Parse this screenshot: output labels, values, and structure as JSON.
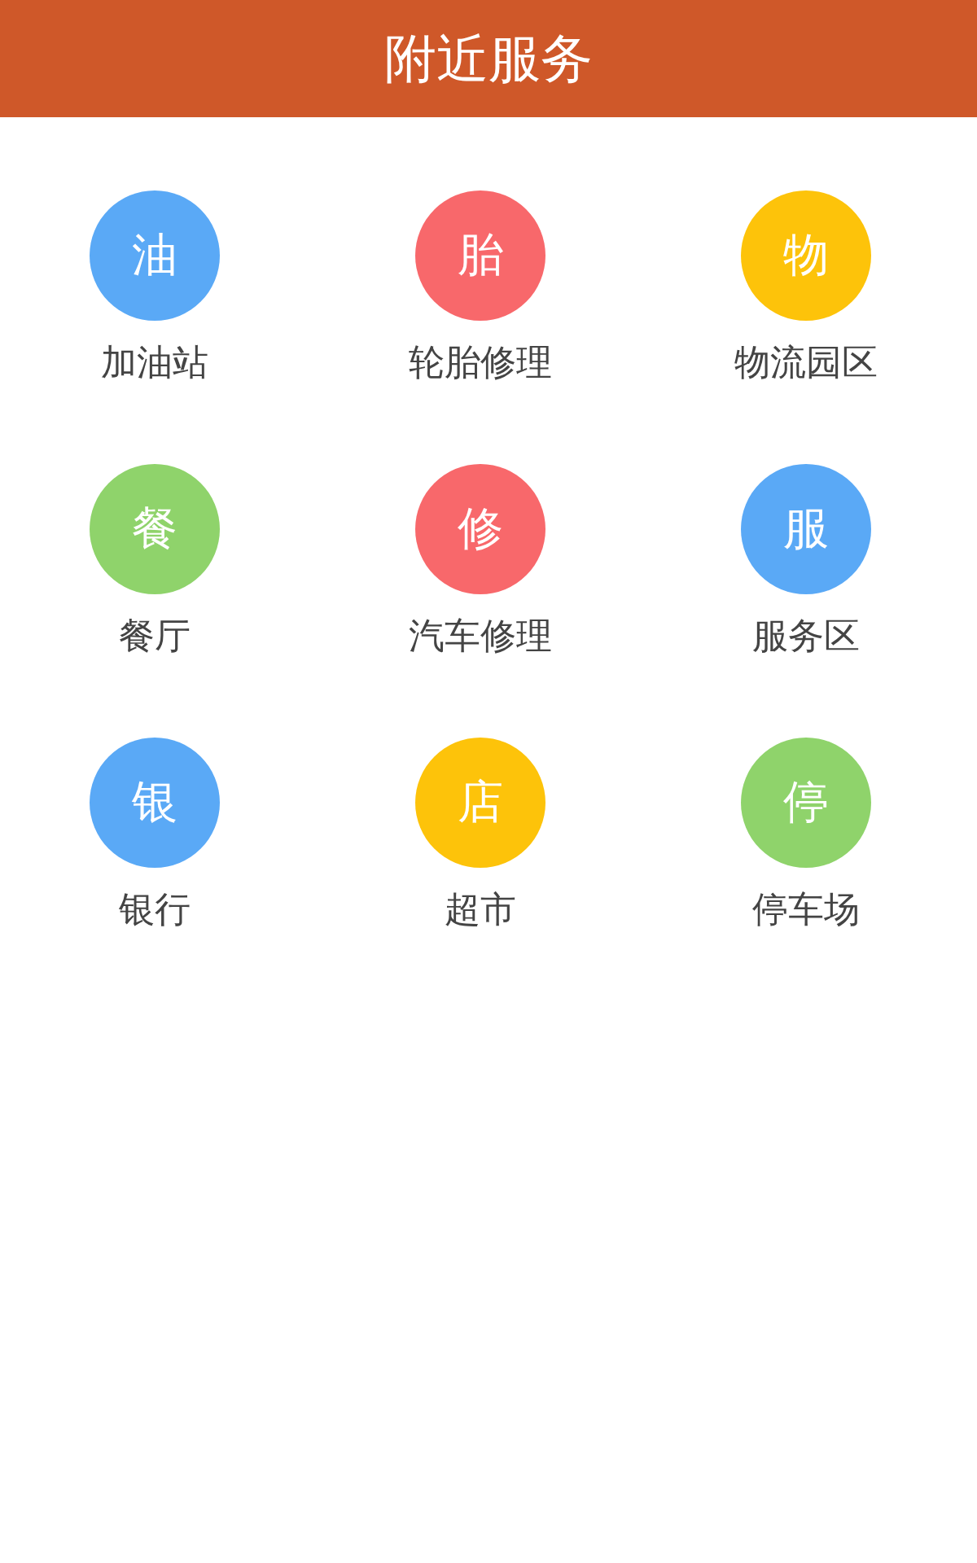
{
  "header": {
    "title": "附近服务"
  },
  "services": [
    {
      "glyph": "油",
      "label": "加油站",
      "color": "#5aa9f6"
    },
    {
      "glyph": "胎",
      "label": "轮胎修理",
      "color": "#f8686b"
    },
    {
      "glyph": "物",
      "label": "物流园区",
      "color": "#fdc30a"
    },
    {
      "glyph": "餐",
      "label": "餐厅",
      "color": "#8fd36b"
    },
    {
      "glyph": "修",
      "label": "汽车修理",
      "color": "#f8686b"
    },
    {
      "glyph": "服",
      "label": "服务区",
      "color": "#5aa9f6"
    },
    {
      "glyph": "银",
      "label": "银行",
      "color": "#5aa9f6"
    },
    {
      "glyph": "店",
      "label": "超市",
      "color": "#fdc30a"
    },
    {
      "glyph": "停",
      "label": "停车场",
      "color": "#8fd36b"
    }
  ]
}
